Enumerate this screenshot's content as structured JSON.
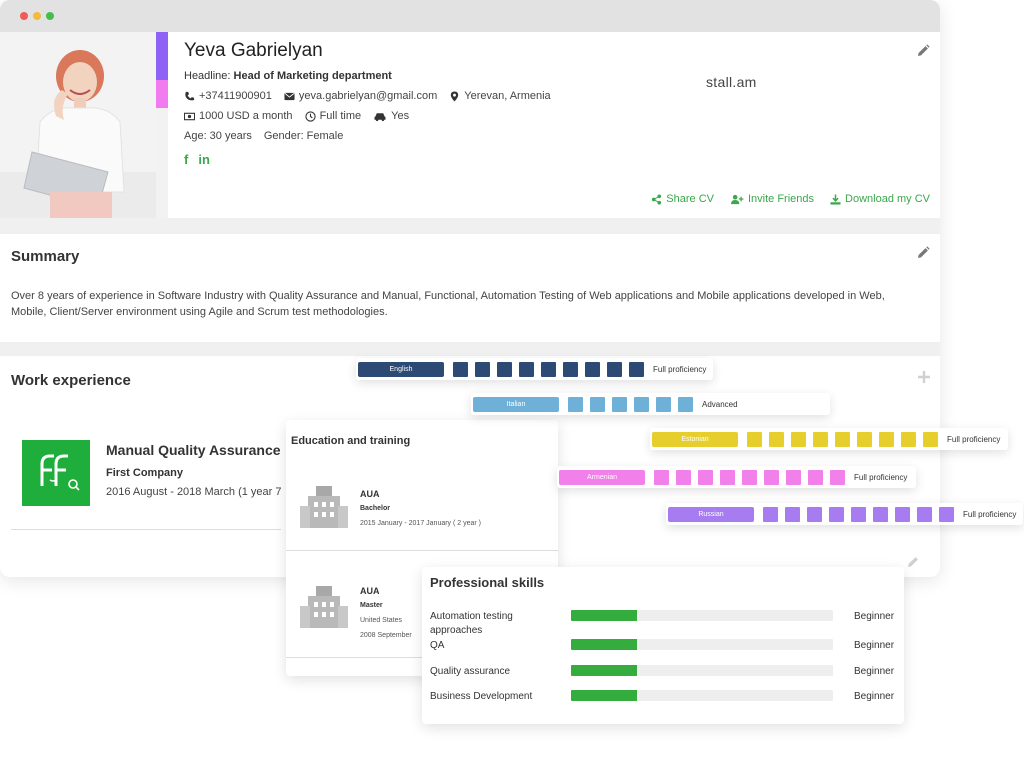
{
  "profile": {
    "name": "Yeva Gabrielyan",
    "headline_label": "Headline: ",
    "headline_value": "Head of Marketing department",
    "phone": "+37411900901",
    "email": "yeva.gabrielyan@gmail.com",
    "location": "Yerevan, Armenia",
    "salary": "1000 USD a month",
    "schedule": "Full time",
    "car": "Yes",
    "age": "Age: 30 years",
    "gender": "Gender: Female",
    "logo_text": "stall.am",
    "actions": [
      "Share CV",
      "Invite Friends",
      "Download my CV"
    ]
  },
  "summary": {
    "title": "Summary",
    "text": "Over 8 years of experience in Software Industry with Quality Assurance and Manual, Functional, Automation Testing of Web applications and Mobile applications developed in Web, Mobile, Client/Server environment using Agile and Scrum test methodologies."
  },
  "work": {
    "title": "Work experience",
    "job_title": "Manual Quality Assurance",
    "company": "First Company",
    "dates": "2016 August - 2018 March (1 year 7"
  },
  "education": {
    "title": "Education and training",
    "items": [
      {
        "name": "AUA",
        "degree": "Bachelor",
        "line1": "2015 January - 2017 January ( 2 year )",
        "line2": ""
      },
      {
        "name": "AUA",
        "degree": "Master",
        "line1": "United States",
        "line2": "2008 September"
      }
    ]
  },
  "languages": [
    {
      "name": "English",
      "level": "Full proficiency",
      "color": "#2c4a73",
      "squares": 9
    },
    {
      "name": "Italian",
      "level": "Advanced",
      "color": "#6fb0d9",
      "squares": 6
    },
    {
      "name": "Estonian",
      "level": "Full proficiency",
      "color": "#e6cf2c",
      "squares": 9
    },
    {
      "name": "Armenian",
      "level": "Full proficiency",
      "color": "#f280ea",
      "squares": 9
    },
    {
      "name": "Russian",
      "level": "Full proficiency",
      "color": "#a77cf0",
      "squares": 9
    }
  ],
  "skills": {
    "title": "Professional skills",
    "items": [
      {
        "name": "Automation testing approaches",
        "level": "Beginner",
        "fill": 0.25
      },
      {
        "name": "QA",
        "level": "Beginner",
        "fill": 0.25
      },
      {
        "name": "Quality assurance",
        "level": "Beginner",
        "fill": 0.25
      },
      {
        "name": "Business Development",
        "level": "Beginner",
        "fill": 0.25
      }
    ]
  },
  "colors": {
    "accent_green": "#3aa84b",
    "bar_green": "#35ad3e",
    "purple": "#8e62f5",
    "pink": "#f17cf0"
  },
  "icons": [
    "phone-icon",
    "email-icon",
    "location-icon",
    "money-icon",
    "clock-icon",
    "car-icon",
    "facebook-icon",
    "linkedin-icon",
    "share-icon",
    "invite-icon",
    "download-icon",
    "pencil-icon",
    "plus-icon",
    "university-icon"
  ]
}
